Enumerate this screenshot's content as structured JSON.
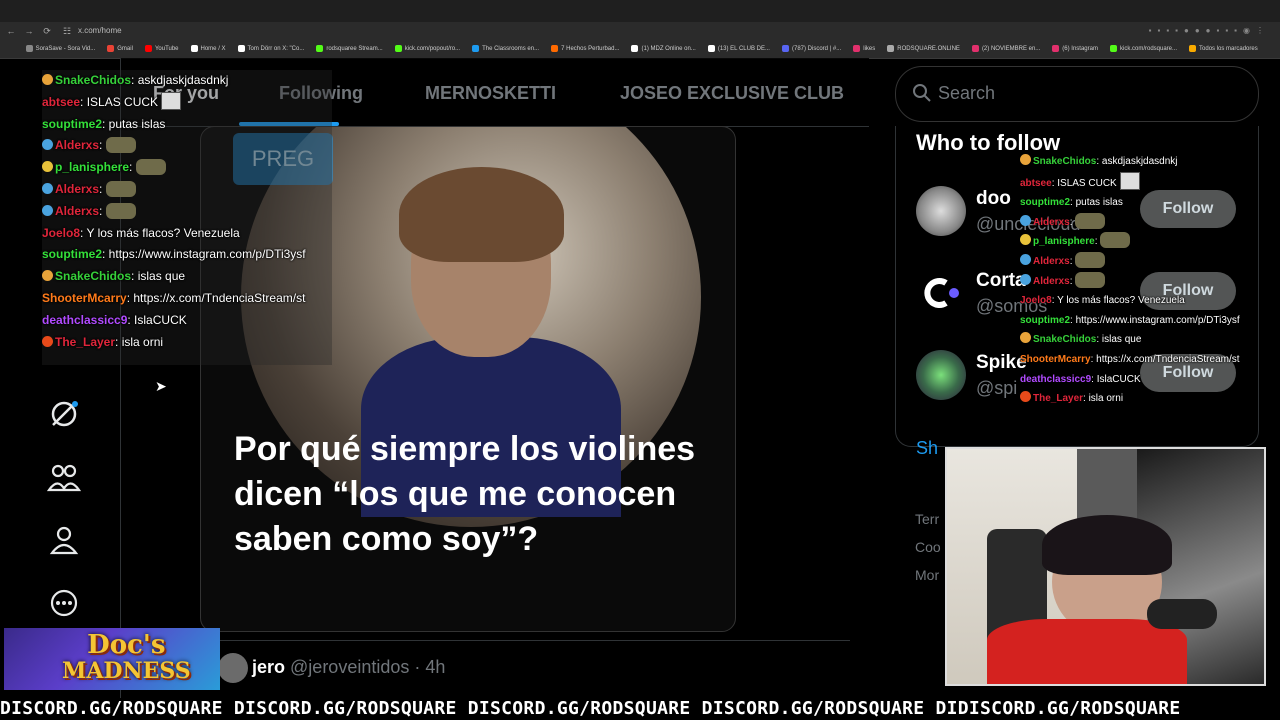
{
  "browser": {
    "url": "x.com/home",
    "bookmarks": [
      "SoraSave - Sora Vid...",
      "Gmail",
      "YouTube",
      "Home / X",
      "Tom Dörr on X: \"Co...",
      "rodsquaree Stream...",
      "kick.com/popout/ro...",
      "The Classrooms en...",
      "7 Hechos Perturbad...",
      "(1) MDZ Online on...",
      "(13) EL CLUB DE...",
      "(787) Discord | #...",
      "likes",
      "RODSQUARE.ONLINE",
      "(2) NOVIEMBRE en...",
      "(6) Instagram",
      "kick.com/rodsquare...",
      "Todos los marcadores"
    ]
  },
  "feed": {
    "tabs": [
      "For you",
      "Following",
      "MERNOSKETTI",
      "JOSEO EXCLUSIVE CLUB"
    ],
    "post_caption": "Por qué siempre los violines dicen “los que me conocen saben como soy”?",
    "preg_button": "PREG",
    "next_post": {
      "name": "jero",
      "handle": "@jeroveintidos · 4h"
    }
  },
  "sidebar": {
    "search_placeholder": "Search",
    "who_to_follow_title": "Who to follow",
    "suggestions": [
      {
        "name": "doo",
        "handle": "@unclecloud",
        "button": "Follow"
      },
      {
        "name": "Corta",
        "handle": "@somos",
        "button": "Follow"
      },
      {
        "name": "Spike",
        "handle": "@spi",
        "button": "Follow"
      }
    ],
    "show_more": "Sh",
    "footer_links": [
      "Terr",
      "Coo",
      "Mor"
    ]
  },
  "chat": [
    {
      "user": "SnakeChidos",
      "color": "#36d13a",
      "msg": "askdjaskjdasdnkj",
      "badge": "#e8a33a"
    },
    {
      "user": "abtsee",
      "color": "#e0263b",
      "msg": "ISLAS CUCK",
      "emote": "box"
    },
    {
      "user": "souptime2",
      "color": "#34e03a",
      "msg": "putas islas"
    },
    {
      "user": "Alderxs",
      "color": "#e0263b",
      "msg": "",
      "emote": "emote",
      "badge": "#4aa3df"
    },
    {
      "user": "p_lanisphere",
      "color": "#34e03a",
      "msg": "",
      "emote": "emote",
      "badge": "#e8c23a"
    },
    {
      "user": "Alderxs",
      "color": "#e0263b",
      "msg": "",
      "emote": "emote",
      "badge": "#4aa3df"
    },
    {
      "user": "Alderxs",
      "color": "#e0263b",
      "msg": "",
      "emote": "emote",
      "badge": "#4aa3df"
    },
    {
      "user": "Joelo8",
      "color": "#e0263b",
      "msg": "Y los más flacos? Venezuela"
    },
    {
      "user": "souptime2",
      "color": "#34e03a",
      "msg": "https://www.instagram.com/p/DTi3ysf"
    },
    {
      "user": "SnakeChidos",
      "color": "#36d13a",
      "msg": "islas que",
      "badge": "#e8a33a"
    },
    {
      "user": "ShooterMcarry",
      "color": "#ff7a1a",
      "msg": "https://x.com/TndenciaStream/st"
    },
    {
      "user": "deathclassicc9",
      "color": "#b14bff",
      "msg": "IslaCUCK"
    },
    {
      "user": "The_Layer",
      "color": "#e0263b",
      "msg": "isla orni",
      "badge": "#e84a1a"
    }
  ],
  "game_logo": {
    "line1": "Doc's",
    "line2": "MADNESS"
  },
  "ticker": "DISCORD.GG/RODSQUARE DISCORD.GG/RODSQUARE DISCORD.GG/RODSQUARE DISCORD.GG/RODSQUARE DIDISCORD.GG/RODSQUARE",
  "colors": {
    "accent": "#1d9bf0",
    "background": "#000000",
    "muted": "#71767b"
  }
}
